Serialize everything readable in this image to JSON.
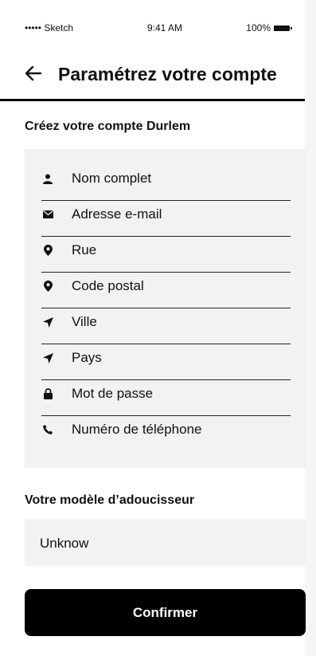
{
  "status_bar": {
    "carrier": "••••• Sketch",
    "time": "9:41 AM",
    "battery": "100%"
  },
  "header": {
    "back_icon": "arrow-left-icon",
    "title": "Paramétrez votre compte"
  },
  "account_section": {
    "title": "Créez votre compte Durlem"
  },
  "fields": [
    {
      "icon": "user-icon",
      "label": "Nom complet"
    },
    {
      "icon": "mail-icon",
      "label": "Adresse e-mail"
    },
    {
      "icon": "location-pin-icon",
      "label": "Rue"
    },
    {
      "icon": "location-pin-icon",
      "label": "Code postal"
    },
    {
      "icon": "navigation-arrow-icon",
      "label": "Ville"
    },
    {
      "icon": "navigation-arrow-icon",
      "label": "Pays"
    },
    {
      "icon": "lock-icon",
      "label": "Mot de passe"
    },
    {
      "icon": "phone-icon",
      "label": "Numéro de téléphone"
    }
  ],
  "softener_section": {
    "title": "Votre modèle d’adoucisseur",
    "value": "Unknow"
  },
  "confirm_button": {
    "label": "Confirmer"
  },
  "colors": {
    "accent": "#000000",
    "field_bg": "#f2f2f2",
    "text": "#111111"
  }
}
